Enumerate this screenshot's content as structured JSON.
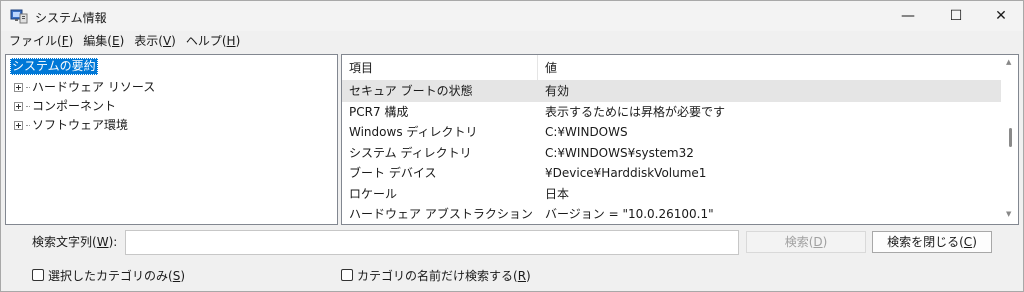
{
  "window": {
    "title": "システム情報",
    "minimize_glyph": "—",
    "maximize_glyph": "☐",
    "close_glyph": "✕"
  },
  "menu": [
    {
      "label": "ファイル(",
      "key": "F",
      "end": ")"
    },
    {
      "label": "編集(",
      "key": "E",
      "end": ")"
    },
    {
      "label": "表示(",
      "key": "V",
      "end": ")"
    },
    {
      "label": "ヘルプ(",
      "key": "H",
      "end": ")"
    }
  ],
  "tree": {
    "root": "システムの要約",
    "children": [
      "ハードウェア リソース",
      "コンポーネント",
      "ソフトウェア環境"
    ]
  },
  "list": {
    "headers": {
      "item": "項目",
      "value": "値"
    },
    "rows": [
      {
        "item": "セキュア ブートの状態",
        "value": "有効",
        "selected": true
      },
      {
        "item": "PCR7 構成",
        "value": "表示するためには昇格が必要です"
      },
      {
        "item": "Windows ディレクトリ",
        "value": "C:¥WINDOWS"
      },
      {
        "item": "システム ディレクトリ",
        "value": "C:¥WINDOWS¥system32"
      },
      {
        "item": "ブート デバイス",
        "value": "¥Device¥HarddiskVolume1"
      },
      {
        "item": "ロケール",
        "value": "日本"
      },
      {
        "item": "ハードウェア アブストラクション レイヤー",
        "value": "バージョン = \"10.0.26100.1\""
      }
    ]
  },
  "find": {
    "label": "検索文字列(",
    "label_key": "W",
    "label_end": "):",
    "value": "",
    "search_button": {
      "label": "検索(",
      "key": "D",
      "end": ")"
    },
    "close_button": {
      "label": "検索を閉じる(",
      "key": "C",
      "end": ")"
    },
    "checkbox_selected_category": {
      "label": "選択したカテゴリのみ(",
      "key": "S",
      "end": ")",
      "checked": false
    },
    "checkbox_category_names": {
      "label": "カテゴリの名前だけ検索する(",
      "key": "R",
      "end": ")",
      "checked": false
    }
  },
  "colors": {
    "accent": "#0078d7",
    "selected_row": "#e5e5e5",
    "disabled_text": "#a0a0a0"
  }
}
